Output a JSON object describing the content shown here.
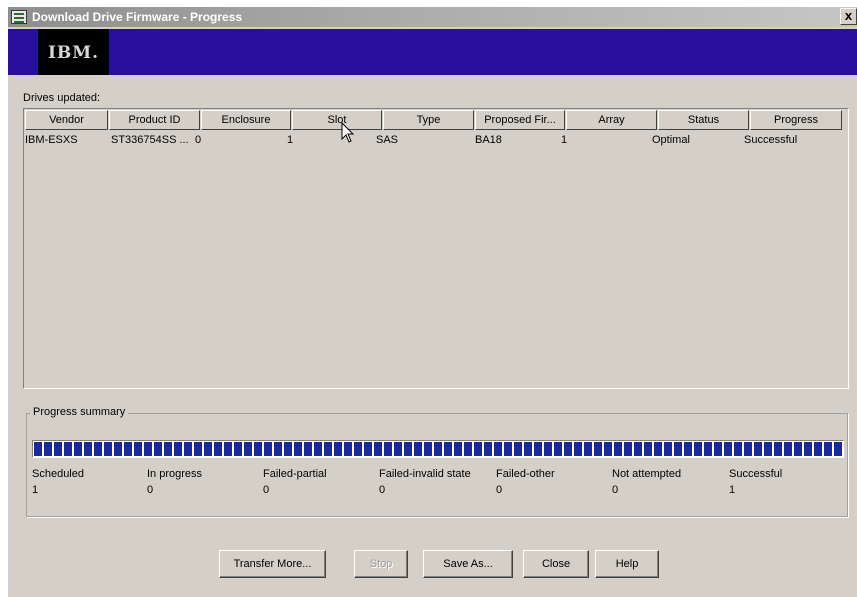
{
  "window": {
    "title": "Download Drive Firmware - Progress",
    "close_glyph": "x"
  },
  "banner": {
    "logo_text": "IBM."
  },
  "drives": {
    "label": "Drives updated:",
    "columns": [
      "Vendor",
      "Product ID",
      "Enclosure",
      "Slot",
      "Type",
      "Proposed Fir...",
      "Array",
      "Status",
      "Progress"
    ],
    "rows": [
      {
        "vendor": "IBM-ESXS",
        "product_id": "ST336754SS ...",
        "enclosure": "0",
        "slot": "1",
        "type": "SAS",
        "proposed_firmware": "BA18",
        "array": "1",
        "status": "Optimal",
        "progress": "Successful"
      }
    ]
  },
  "summary": {
    "label": "Progress summary",
    "progress_fraction": 1.0,
    "progress_color": "#1a2a9c",
    "stats": [
      {
        "label": "Scheduled",
        "value": "1"
      },
      {
        "label": "In progress",
        "value": "0"
      },
      {
        "label": "Failed-partial",
        "value": "0"
      },
      {
        "label": "Failed-invalid state",
        "value": "0"
      },
      {
        "label": "Failed-other",
        "value": "0"
      },
      {
        "label": "Not attempted",
        "value": "0"
      },
      {
        "label": "Successful",
        "value": "1"
      }
    ]
  },
  "buttons": {
    "transfer_more": "Transfer More...",
    "stop": "Stop",
    "save_as": "Save As...",
    "close": "Close",
    "help": "Help"
  },
  "colors": {
    "banner": "#2a0f9c",
    "face": "#d4d0c8"
  }
}
